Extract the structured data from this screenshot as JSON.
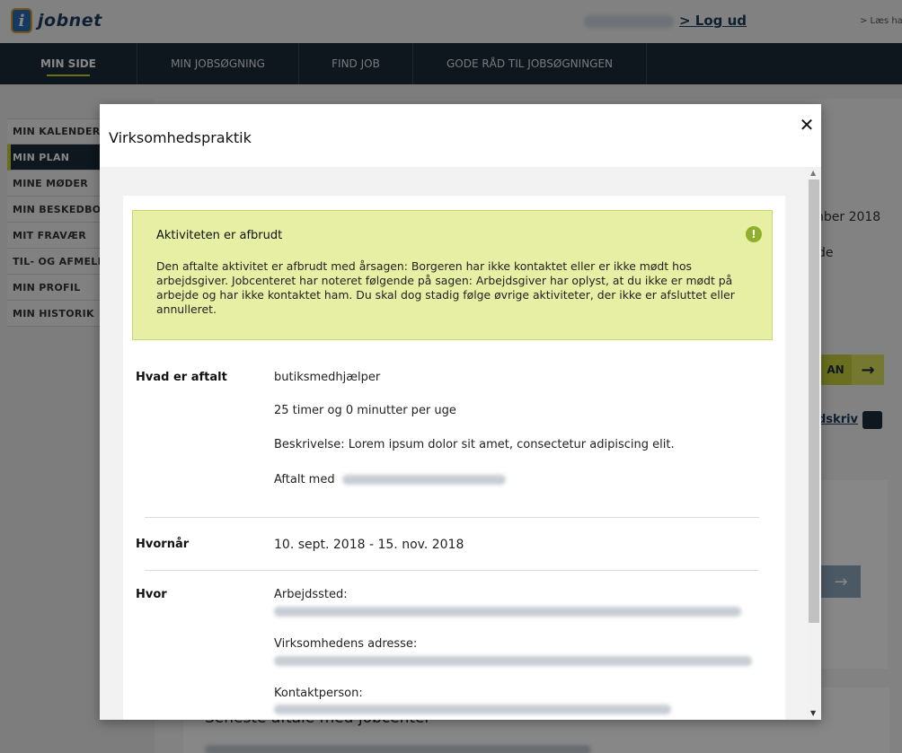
{
  "header": {
    "logo_mark": "i",
    "logo_text": "jobnet",
    "logout_label": "> Log ud",
    "read_aloud_label": "> Læs ha"
  },
  "nav": {
    "items": [
      {
        "label": "MIN SIDE",
        "active": true
      },
      {
        "label": "MIN JOBSØGNING",
        "active": false
      },
      {
        "label": "FIND JOB",
        "active": false
      },
      {
        "label": "GODE RÅD TIL JOBSØGNINGEN",
        "active": false
      }
    ]
  },
  "sidebar": {
    "items": [
      {
        "label": "MIN KALENDER",
        "active": false
      },
      {
        "label": "MIN PLAN",
        "active": true
      },
      {
        "label": "MINE MØDER",
        "active": false
      },
      {
        "label": "MIN BESKEDBOKS",
        "active": false
      },
      {
        "label": "MIT FRAVÆR",
        "active": false
      },
      {
        "label": "TIL- OG AFMELDING",
        "active": false
      },
      {
        "label": "MIN PROFIL",
        "active": false
      },
      {
        "label": "MIN HISTORIK",
        "active": false
      }
    ]
  },
  "background": {
    "date_fragment": "nber 2018",
    "text_fragment": "de",
    "button_fragment": "AN",
    "button_arrow": "→",
    "print_label": "dskriv",
    "card_arrow": "→",
    "section_heading": "Seneste aftale med jobcenter"
  },
  "modal": {
    "title": "Virksomhedspraktik",
    "close_label": "✕",
    "alert": {
      "title": "Aktiviteten er afbrudt",
      "icon": "!",
      "text": "Den aftalte aktivitet er afbrudt med årsagen: Borgeren har ikke kontaktet eller er ikke mødt hos arbejdsgiver. Jobcenteret har noteret følgende på sagen: Arbejdsgiver har oplyst, at du ikke er mødt på arbejde og har ikke kontaktet ham. Du skal dog stadig følge øvrige aktiviteter, der ikke er afsluttet eller annulleret."
    },
    "what": {
      "label": "Hvad er aftalt",
      "job": "butiksmedhjælper",
      "hours": "25 timer og 0 minutter per uge",
      "description": "Beskrivelse: Lorem ipsum dolor sit amet, consectetur adipiscing elit.",
      "agreed_with_label": "Aftalt med"
    },
    "when": {
      "label": "Hvornår",
      "period": "10. sept. 2018 - 15. nov. 2018"
    },
    "where": {
      "label": "Hvor",
      "workplace_label": "Arbejdssted:",
      "company_address_label": "Virksomhedens adresse:",
      "contact_label": "Kontaktperson:"
    }
  },
  "colors": {
    "nav_bg": "#1b2a3a",
    "accent": "#c7d23a",
    "alert_bg": "#e6efa3",
    "alert_icon": "#8fb02a",
    "link": "#1c3b5a"
  }
}
